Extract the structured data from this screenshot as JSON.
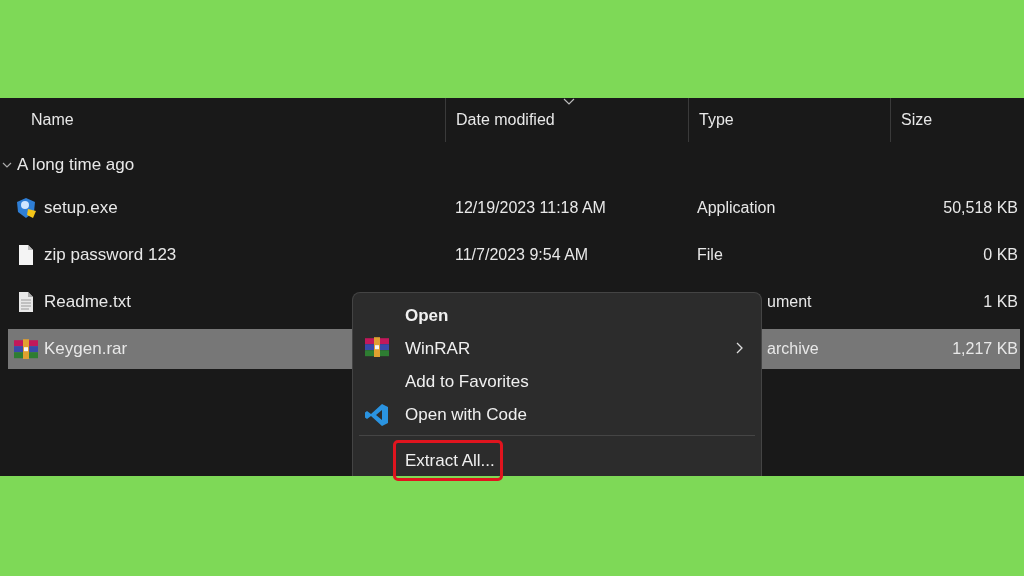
{
  "columns": [
    {
      "label": "Name",
      "sorted": false
    },
    {
      "label": "Date modified",
      "sorted": true
    },
    {
      "label": "Type",
      "sorted": false
    },
    {
      "label": "Size",
      "sorted": false
    }
  ],
  "group": {
    "label": "A long time ago",
    "expanded": true
  },
  "rows": [
    {
      "kind": "exe",
      "name": "setup.exe",
      "date": "12/19/2023 11:18 AM",
      "type": "Application",
      "size": "50,518 KB",
      "selected": false,
      "covered": false
    },
    {
      "kind": "blank",
      "name": "zip password 123",
      "date": "11/7/2023 9:54 AM",
      "type": "File",
      "size": "0 KB",
      "selected": false,
      "covered": false
    },
    {
      "kind": "text",
      "name": "Readme.txt",
      "type": "ument",
      "size": "1 KB",
      "selected": false,
      "covered": true
    },
    {
      "kind": "rar",
      "name": "Keygen.rar",
      "type": "archive",
      "size": "1,217 KB",
      "selected": true,
      "covered": true
    }
  ],
  "context_menu": {
    "items": [
      {
        "kind": "plain",
        "label": "Open",
        "default": true,
        "highlighted": false
      },
      {
        "kind": "rar",
        "label": "WinRAR",
        "submenu": true,
        "default": false,
        "highlighted": false
      },
      {
        "kind": "plain",
        "label": "Add to Favorites",
        "default": false,
        "highlighted": false
      },
      {
        "kind": "code",
        "label": "Open with Code",
        "default": false,
        "highlighted": false
      },
      {
        "kind": "separator"
      },
      {
        "kind": "plain",
        "label": "Extract All...",
        "default": false,
        "highlighted": true
      }
    ]
  }
}
